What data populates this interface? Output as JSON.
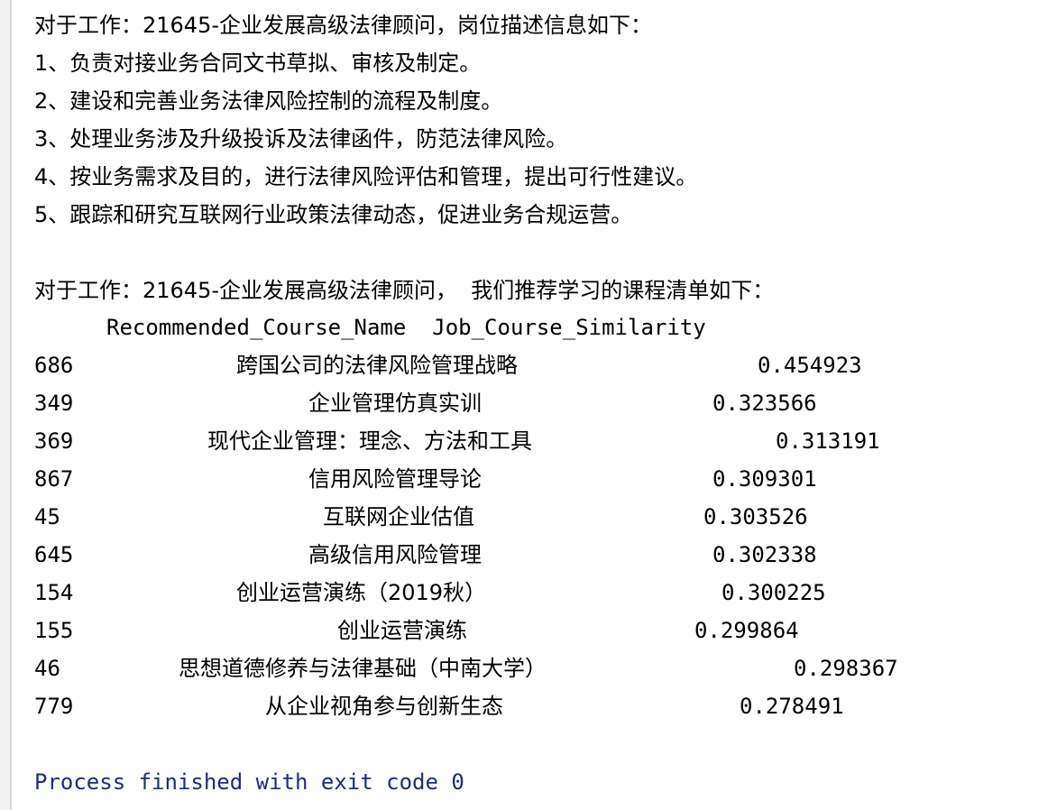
{
  "console": {
    "job_description_header": "对于工作：21645-企业发展高级法律顾问，岗位描述信息如下：",
    "job_duties": [
      "1、负责对接业务合同文书草拟、审核及制定。",
      "2、建设和完善业务法律风险控制的流程及制度。",
      "3、处理业务涉及升级投诉及法律函件，防范法律风险。",
      "4、按业务需求及目的，进行法律风险评估和管理，提出可行性建议。",
      "5、跟踪和研究互联网行业政策法律动态，促进业务合规运营。"
    ],
    "recommendation_header": "对于工作：21645-企业发展高级法律顾问，  我们推荐学习的课程清单如下：",
    "table": {
      "columns": [
        "Recommended_Course_Name",
        "Job_Course_Similarity"
      ],
      "rows": [
        {
          "index": "686",
          "name": "跨国公司的法律风险管理战略",
          "similarity": "0.454923"
        },
        {
          "index": "349",
          "name": "企业管理仿真实训",
          "similarity": "0.323566"
        },
        {
          "index": "369",
          "name": "现代企业管理：理念、方法和工具",
          "similarity": "0.313191"
        },
        {
          "index": "867",
          "name": "信用风险管理导论",
          "similarity": "0.309301"
        },
        {
          "index": "45",
          "name": "互联网企业估值",
          "similarity": "0.303526"
        },
        {
          "index": "645",
          "name": "高级信用风险管理",
          "similarity": "0.302338"
        },
        {
          "index": "154",
          "name": "创业运营演练（2019秋）",
          "similarity": "0.300225"
        },
        {
          "index": "155",
          "name": "创业运营演练",
          "similarity": "0.299864"
        },
        {
          "index": "46",
          "name": "思想道德修养与法律基础（中南大学）",
          "similarity": "0.298367"
        },
        {
          "index": "779",
          "name": "从企业视角参与创新生态",
          "similarity": "0.278491"
        }
      ]
    },
    "exit_message": "Process finished with exit code 0",
    "colors": {
      "background": "#ffffff",
      "text": "#000000",
      "exit_message": "#1a2a8c"
    }
  }
}
